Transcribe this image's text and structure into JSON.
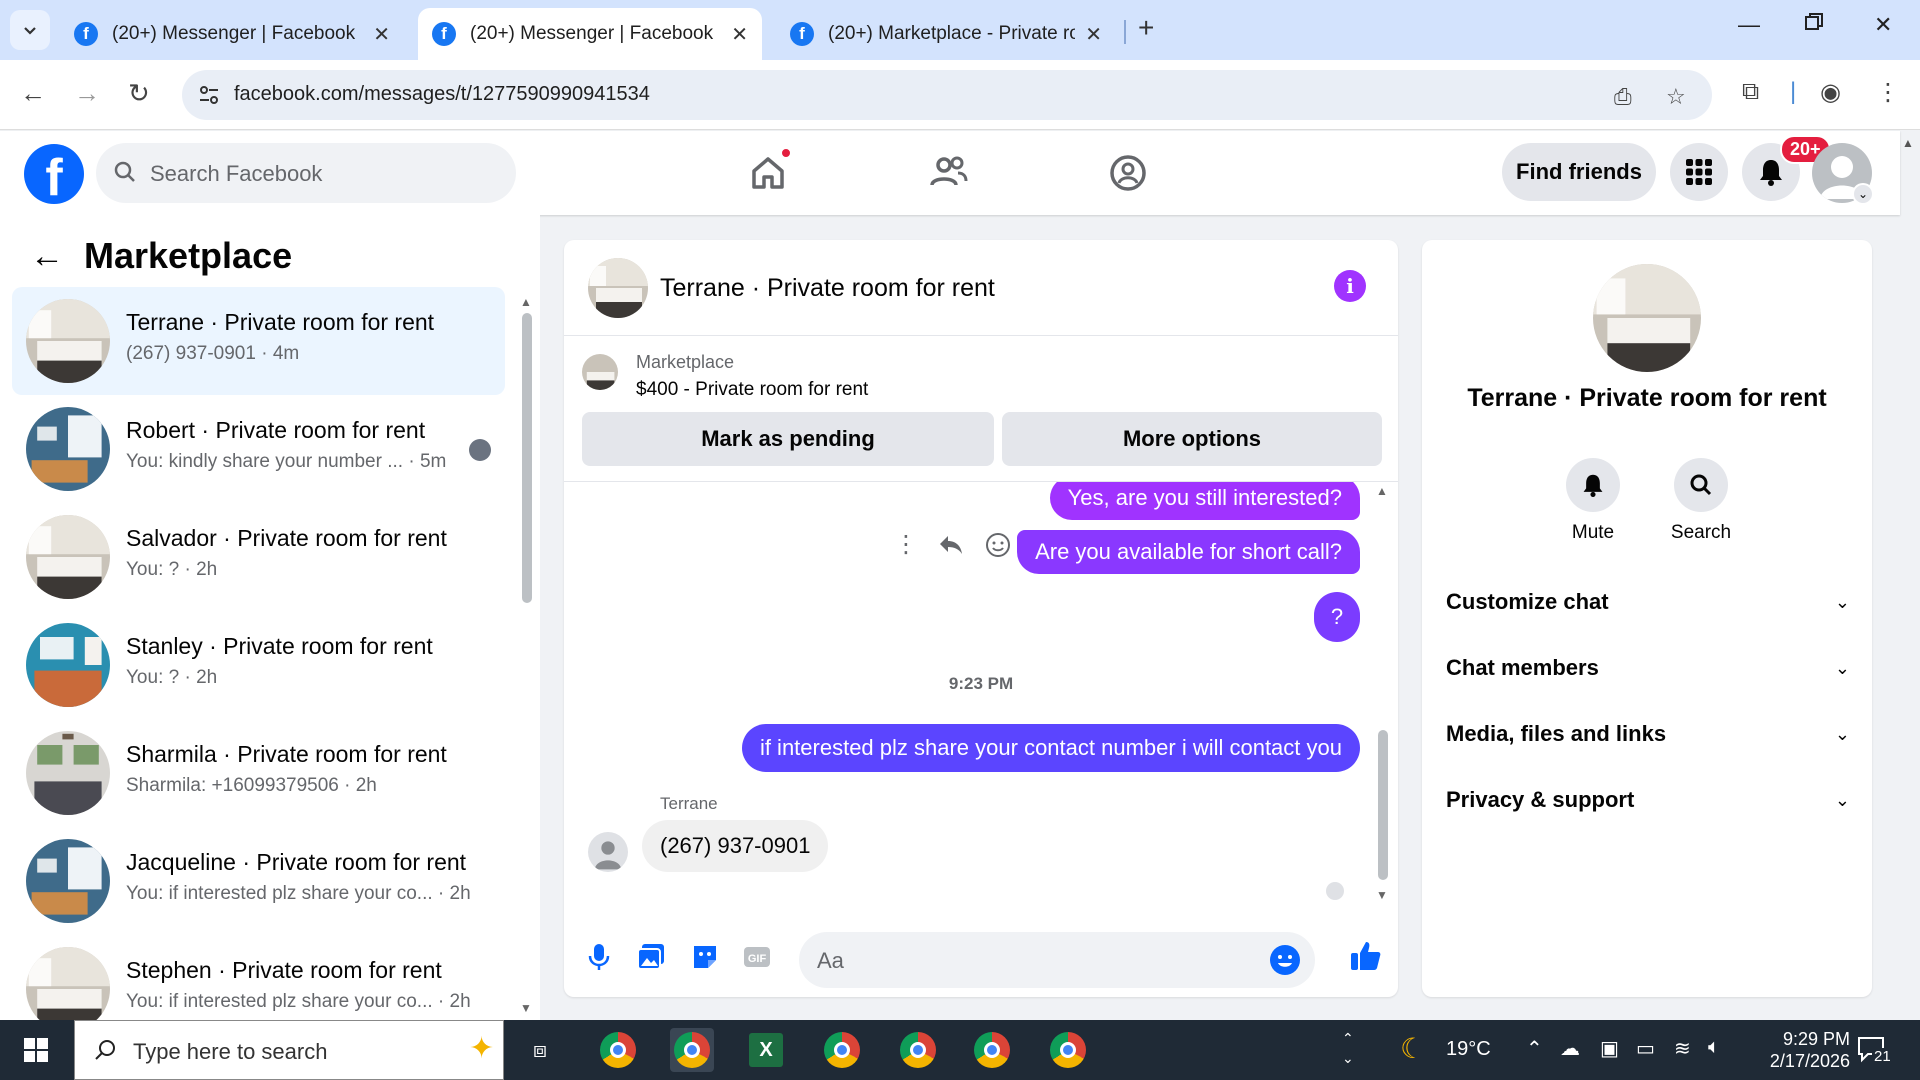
{
  "browser": {
    "tabs": [
      {
        "title": "(20+) Messenger | Facebook",
        "active": false
      },
      {
        "title": "(20+) Messenger | Facebook",
        "active": true
      },
      {
        "title": "(20+) Marketplace - Private roo",
        "active": false
      }
    ],
    "url": "facebook.com/messages/t/1277590990941534"
  },
  "fb": {
    "search_placeholder": "Search Facebook",
    "find_friends": "Find friends",
    "notif_badge": "20+"
  },
  "sidebar": {
    "title": "Marketplace",
    "conversations": [
      {
        "name": "Terrane · Private room for rent",
        "snippet": "(267) 937-0901 · 4m",
        "active": true,
        "photo": "bed-gray"
      },
      {
        "name": "Robert · Private room for rent",
        "snippet": "You: kindly share your number ... · 5m",
        "active": false,
        "photo": "room-blue",
        "seen": true
      },
      {
        "name": "Salvador · Private room for rent",
        "snippet": "You: ? · 2h",
        "active": false,
        "photo": "bed-gray"
      },
      {
        "name": "Stanley · Private room for rent",
        "snippet": "You: ? · 2h",
        "active": false,
        "photo": "room-teal"
      },
      {
        "name": "Sharmila · Private room for rent",
        "snippet": "Sharmila: +16099379506 · 2h",
        "active": false,
        "photo": "room-white"
      },
      {
        "name": "Jacqueline · Private room for rent",
        "snippet": "You: if interested plz share your co... · 2h",
        "active": false,
        "photo": "room-blue"
      },
      {
        "name": "Stephen · Private room for rent",
        "snippet": "You: if interested plz share your co... · 2h",
        "active": false,
        "photo": "bed-gray"
      }
    ]
  },
  "chat": {
    "title": "Terrane · Private room for rent",
    "listing_label": "Marketplace",
    "listing_price": "$400 - Private room for rent",
    "mark_pending": "Mark as pending",
    "more_options": "More options",
    "messages": {
      "m1": "Yes, are you still interested?",
      "m2": "Are you available for short call?",
      "m3": "?",
      "timestamp": "9:23 PM",
      "m4": "if interested plz share your contact number i will contact you",
      "sender": "Terrane",
      "reply": "(267) 937-0901"
    },
    "composer_placeholder": "Aa"
  },
  "info_panel": {
    "name": "Terrane · Private room for rent",
    "mute": "Mute",
    "search": "Search",
    "sections": [
      "Customize chat",
      "Chat members",
      "Media, files and links",
      "Privacy & support"
    ]
  },
  "taskbar": {
    "search_placeholder": "Type here to search",
    "weather": "19°C",
    "time": "9:29 PM",
    "date": "2/17/2026",
    "notifications": "21"
  },
  "colors": {
    "fb_blue": "#0866ff",
    "bubble_purple": "#a033ff",
    "bubble_violet": "#7b3cff",
    "bubble_indigo": "#5b45ff"
  }
}
